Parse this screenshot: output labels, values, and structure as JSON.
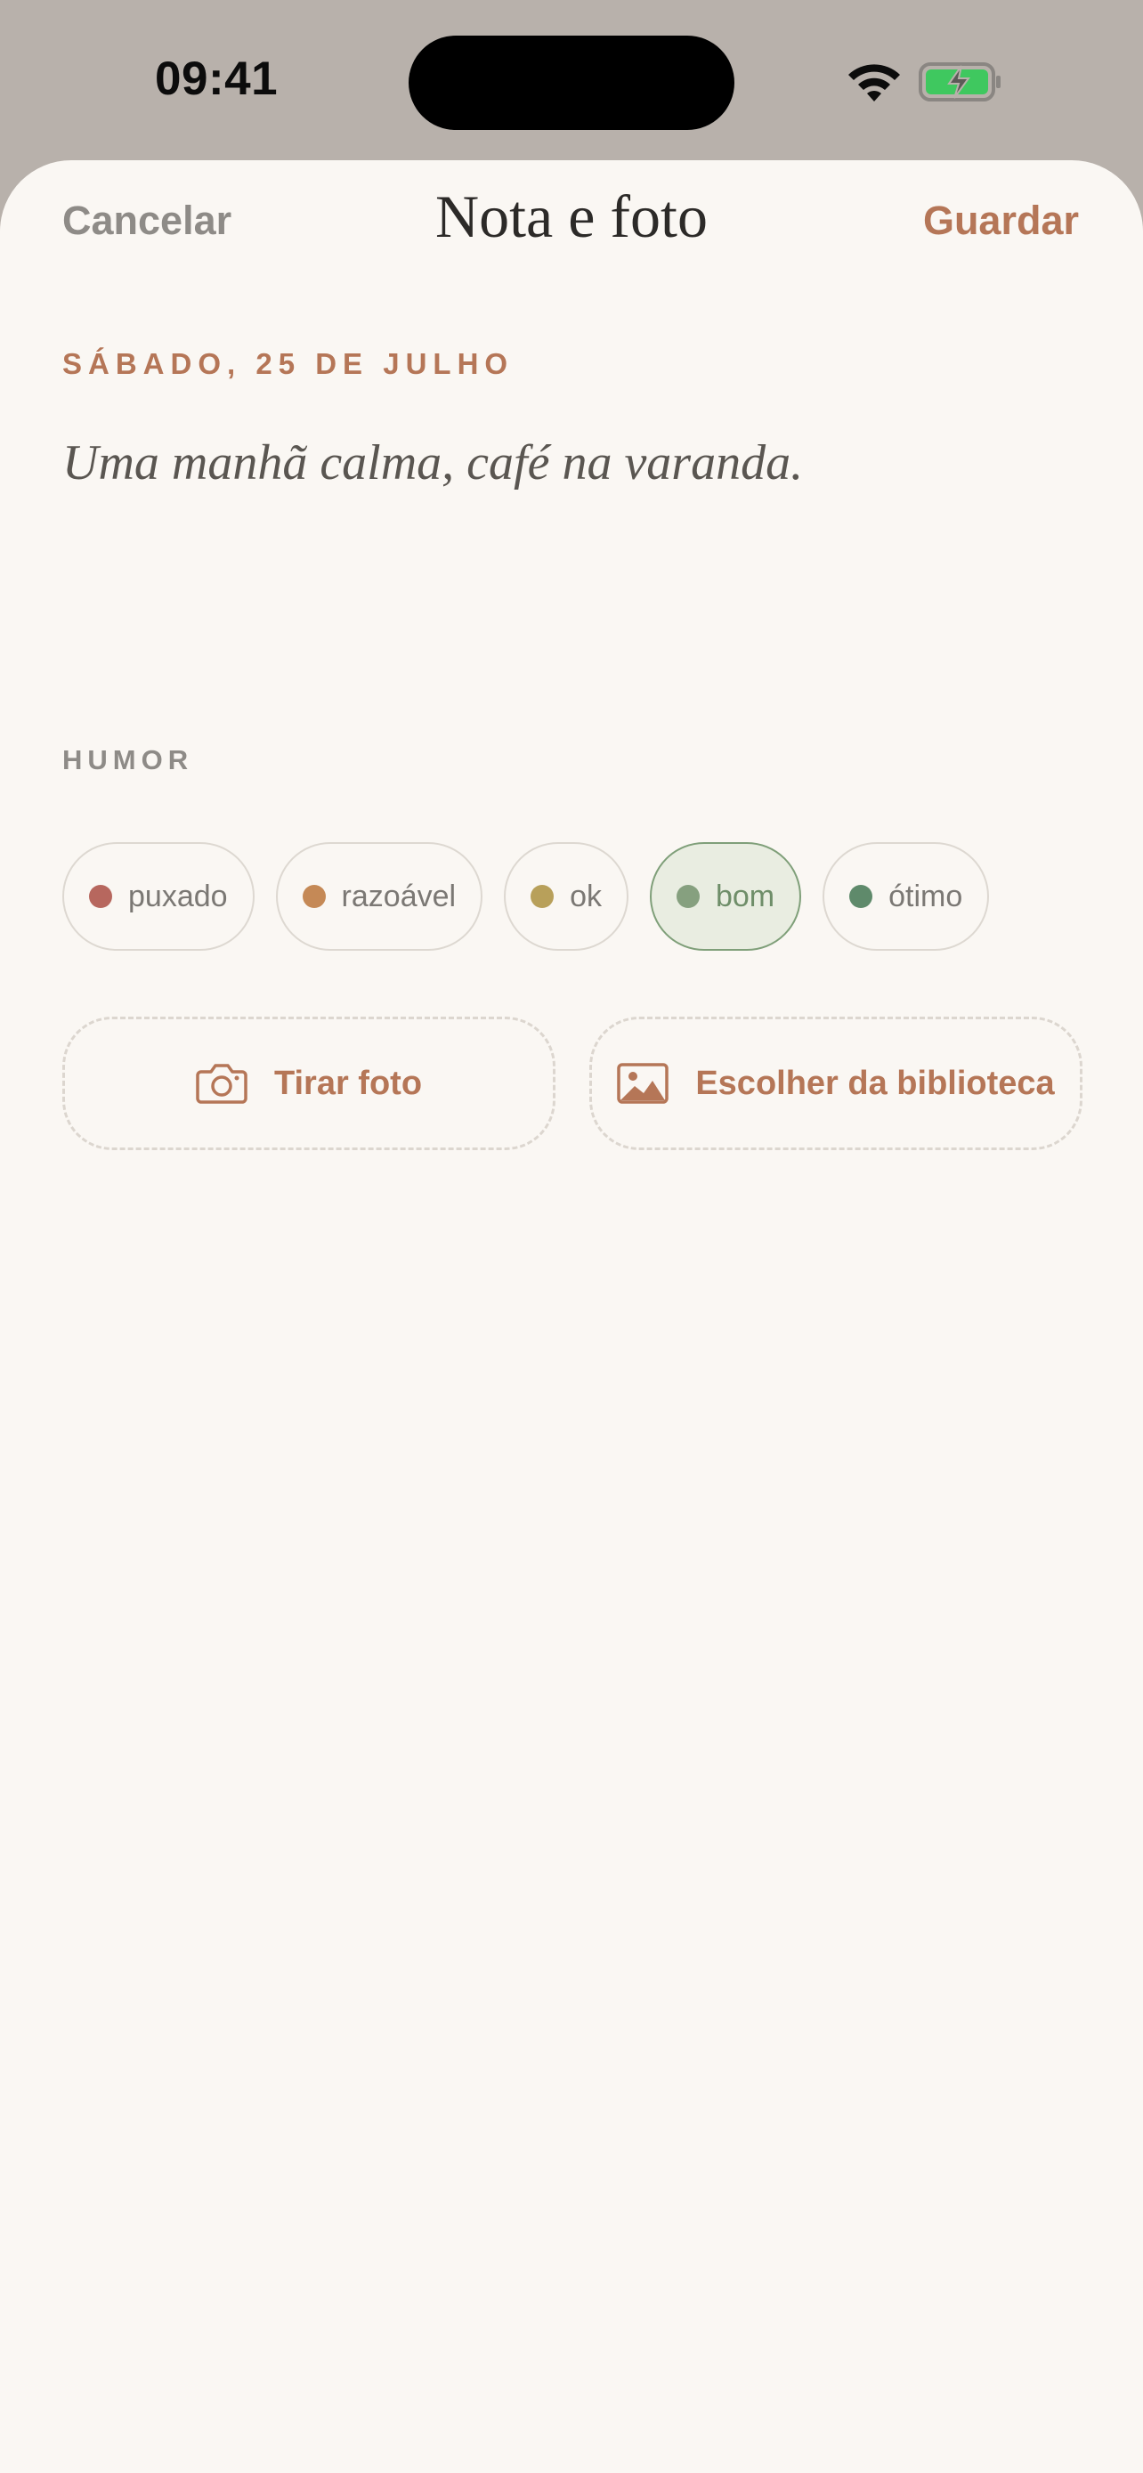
{
  "status_bar": {
    "time": "09:41"
  },
  "nav": {
    "cancel_label": "Cancelar",
    "title": "Nota e foto",
    "save_label": "Guardar"
  },
  "entry": {
    "date": "SÁBADO, 25 DE JULHO",
    "note": "Uma manhã calma, café na varanda."
  },
  "mood_section": {
    "label": "HUMOR",
    "selected": "bom",
    "options": [
      {
        "label": "puxado",
        "color": "#b7675e"
      },
      {
        "label": "razoável",
        "color": "#c58956"
      },
      {
        "label": "ok",
        "color": "#b8a05a"
      },
      {
        "label": "bom",
        "color": "#86a07f"
      },
      {
        "label": "ótimo",
        "color": "#5f8a6b"
      }
    ]
  },
  "photo_actions": {
    "take_photo_label": "Tirar foto",
    "take_photo_icon": "camera-icon",
    "choose_library_label": "Escolher da biblioteca",
    "choose_library_icon": "photo-library-icon"
  },
  "colors": {
    "accent": "#b57657",
    "background": "#faf7f3",
    "selected_mood_border": "#7f9f79",
    "selected_mood_fill": "#e9ede1"
  }
}
